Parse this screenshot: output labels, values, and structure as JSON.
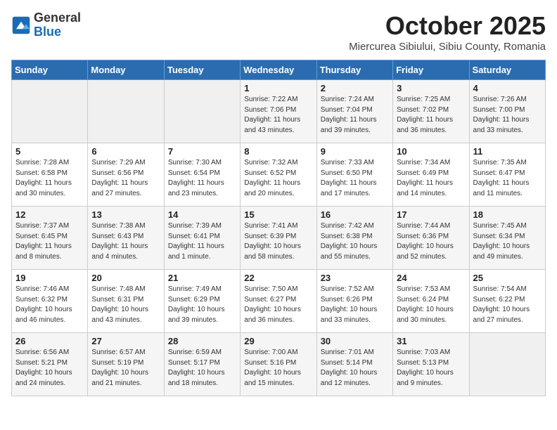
{
  "logo": {
    "general": "General",
    "blue": "Blue"
  },
  "title": "October 2025",
  "location": "Miercurea Sibiului, Sibiu County, Romania",
  "days_of_week": [
    "Sunday",
    "Monday",
    "Tuesday",
    "Wednesday",
    "Thursday",
    "Friday",
    "Saturday"
  ],
  "weeks": [
    [
      {
        "day": "",
        "info": ""
      },
      {
        "day": "",
        "info": ""
      },
      {
        "day": "",
        "info": ""
      },
      {
        "day": "1",
        "info": "Sunrise: 7:22 AM\nSunset: 7:06 PM\nDaylight: 11 hours and 43 minutes."
      },
      {
        "day": "2",
        "info": "Sunrise: 7:24 AM\nSunset: 7:04 PM\nDaylight: 11 hours and 39 minutes."
      },
      {
        "day": "3",
        "info": "Sunrise: 7:25 AM\nSunset: 7:02 PM\nDaylight: 11 hours and 36 minutes."
      },
      {
        "day": "4",
        "info": "Sunrise: 7:26 AM\nSunset: 7:00 PM\nDaylight: 11 hours and 33 minutes."
      }
    ],
    [
      {
        "day": "5",
        "info": "Sunrise: 7:28 AM\nSunset: 6:58 PM\nDaylight: 11 hours and 30 minutes."
      },
      {
        "day": "6",
        "info": "Sunrise: 7:29 AM\nSunset: 6:56 PM\nDaylight: 11 hours and 27 minutes."
      },
      {
        "day": "7",
        "info": "Sunrise: 7:30 AM\nSunset: 6:54 PM\nDaylight: 11 hours and 23 minutes."
      },
      {
        "day": "8",
        "info": "Sunrise: 7:32 AM\nSunset: 6:52 PM\nDaylight: 11 hours and 20 minutes."
      },
      {
        "day": "9",
        "info": "Sunrise: 7:33 AM\nSunset: 6:50 PM\nDaylight: 11 hours and 17 minutes."
      },
      {
        "day": "10",
        "info": "Sunrise: 7:34 AM\nSunset: 6:49 PM\nDaylight: 11 hours and 14 minutes."
      },
      {
        "day": "11",
        "info": "Sunrise: 7:35 AM\nSunset: 6:47 PM\nDaylight: 11 hours and 11 minutes."
      }
    ],
    [
      {
        "day": "12",
        "info": "Sunrise: 7:37 AM\nSunset: 6:45 PM\nDaylight: 11 hours and 8 minutes."
      },
      {
        "day": "13",
        "info": "Sunrise: 7:38 AM\nSunset: 6:43 PM\nDaylight: 11 hours and 4 minutes."
      },
      {
        "day": "14",
        "info": "Sunrise: 7:39 AM\nSunset: 6:41 PM\nDaylight: 11 hours and 1 minute."
      },
      {
        "day": "15",
        "info": "Sunrise: 7:41 AM\nSunset: 6:39 PM\nDaylight: 10 hours and 58 minutes."
      },
      {
        "day": "16",
        "info": "Sunrise: 7:42 AM\nSunset: 6:38 PM\nDaylight: 10 hours and 55 minutes."
      },
      {
        "day": "17",
        "info": "Sunrise: 7:44 AM\nSunset: 6:36 PM\nDaylight: 10 hours and 52 minutes."
      },
      {
        "day": "18",
        "info": "Sunrise: 7:45 AM\nSunset: 6:34 PM\nDaylight: 10 hours and 49 minutes."
      }
    ],
    [
      {
        "day": "19",
        "info": "Sunrise: 7:46 AM\nSunset: 6:32 PM\nDaylight: 10 hours and 46 minutes."
      },
      {
        "day": "20",
        "info": "Sunrise: 7:48 AM\nSunset: 6:31 PM\nDaylight: 10 hours and 43 minutes."
      },
      {
        "day": "21",
        "info": "Sunrise: 7:49 AM\nSunset: 6:29 PM\nDaylight: 10 hours and 39 minutes."
      },
      {
        "day": "22",
        "info": "Sunrise: 7:50 AM\nSunset: 6:27 PM\nDaylight: 10 hours and 36 minutes."
      },
      {
        "day": "23",
        "info": "Sunrise: 7:52 AM\nSunset: 6:26 PM\nDaylight: 10 hours and 33 minutes."
      },
      {
        "day": "24",
        "info": "Sunrise: 7:53 AM\nSunset: 6:24 PM\nDaylight: 10 hours and 30 minutes."
      },
      {
        "day": "25",
        "info": "Sunrise: 7:54 AM\nSunset: 6:22 PM\nDaylight: 10 hours and 27 minutes."
      }
    ],
    [
      {
        "day": "26",
        "info": "Sunrise: 6:56 AM\nSunset: 5:21 PM\nDaylight: 10 hours and 24 minutes."
      },
      {
        "day": "27",
        "info": "Sunrise: 6:57 AM\nSunset: 5:19 PM\nDaylight: 10 hours and 21 minutes."
      },
      {
        "day": "28",
        "info": "Sunrise: 6:59 AM\nSunset: 5:17 PM\nDaylight: 10 hours and 18 minutes."
      },
      {
        "day": "29",
        "info": "Sunrise: 7:00 AM\nSunset: 5:16 PM\nDaylight: 10 hours and 15 minutes."
      },
      {
        "day": "30",
        "info": "Sunrise: 7:01 AM\nSunset: 5:14 PM\nDaylight: 10 hours and 12 minutes."
      },
      {
        "day": "31",
        "info": "Sunrise: 7:03 AM\nSunset: 5:13 PM\nDaylight: 10 hours and 9 minutes."
      },
      {
        "day": "",
        "info": ""
      }
    ]
  ]
}
